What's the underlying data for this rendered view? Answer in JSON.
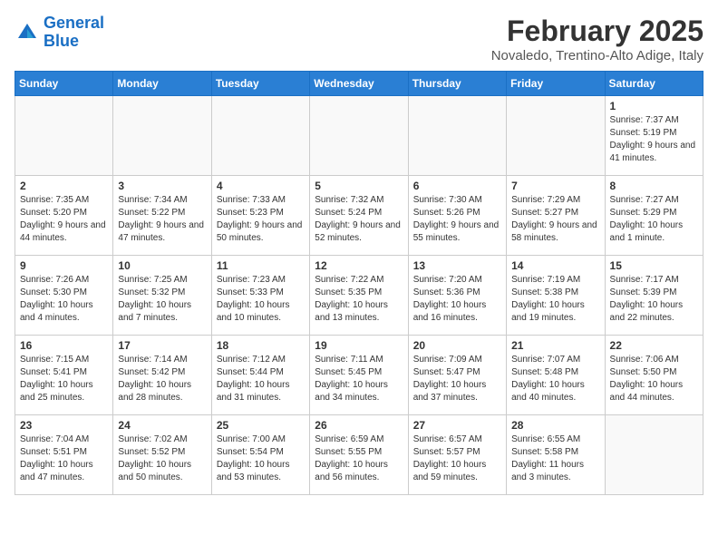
{
  "header": {
    "logo_line1": "General",
    "logo_line2": "Blue",
    "month_year": "February 2025",
    "location": "Novaledo, Trentino-Alto Adige, Italy"
  },
  "weekdays": [
    "Sunday",
    "Monday",
    "Tuesday",
    "Wednesday",
    "Thursday",
    "Friday",
    "Saturday"
  ],
  "weeks": [
    [
      {
        "day": "",
        "info": ""
      },
      {
        "day": "",
        "info": ""
      },
      {
        "day": "",
        "info": ""
      },
      {
        "day": "",
        "info": ""
      },
      {
        "day": "",
        "info": ""
      },
      {
        "day": "",
        "info": ""
      },
      {
        "day": "1",
        "info": "Sunrise: 7:37 AM\nSunset: 5:19 PM\nDaylight: 9 hours and 41 minutes."
      }
    ],
    [
      {
        "day": "2",
        "info": "Sunrise: 7:35 AM\nSunset: 5:20 PM\nDaylight: 9 hours and 44 minutes."
      },
      {
        "day": "3",
        "info": "Sunrise: 7:34 AM\nSunset: 5:22 PM\nDaylight: 9 hours and 47 minutes."
      },
      {
        "day": "4",
        "info": "Sunrise: 7:33 AM\nSunset: 5:23 PM\nDaylight: 9 hours and 50 minutes."
      },
      {
        "day": "5",
        "info": "Sunrise: 7:32 AM\nSunset: 5:24 PM\nDaylight: 9 hours and 52 minutes."
      },
      {
        "day": "6",
        "info": "Sunrise: 7:30 AM\nSunset: 5:26 PM\nDaylight: 9 hours and 55 minutes."
      },
      {
        "day": "7",
        "info": "Sunrise: 7:29 AM\nSunset: 5:27 PM\nDaylight: 9 hours and 58 minutes."
      },
      {
        "day": "8",
        "info": "Sunrise: 7:27 AM\nSunset: 5:29 PM\nDaylight: 10 hours and 1 minute."
      }
    ],
    [
      {
        "day": "9",
        "info": "Sunrise: 7:26 AM\nSunset: 5:30 PM\nDaylight: 10 hours and 4 minutes."
      },
      {
        "day": "10",
        "info": "Sunrise: 7:25 AM\nSunset: 5:32 PM\nDaylight: 10 hours and 7 minutes."
      },
      {
        "day": "11",
        "info": "Sunrise: 7:23 AM\nSunset: 5:33 PM\nDaylight: 10 hours and 10 minutes."
      },
      {
        "day": "12",
        "info": "Sunrise: 7:22 AM\nSunset: 5:35 PM\nDaylight: 10 hours and 13 minutes."
      },
      {
        "day": "13",
        "info": "Sunrise: 7:20 AM\nSunset: 5:36 PM\nDaylight: 10 hours and 16 minutes."
      },
      {
        "day": "14",
        "info": "Sunrise: 7:19 AM\nSunset: 5:38 PM\nDaylight: 10 hours and 19 minutes."
      },
      {
        "day": "15",
        "info": "Sunrise: 7:17 AM\nSunset: 5:39 PM\nDaylight: 10 hours and 22 minutes."
      }
    ],
    [
      {
        "day": "16",
        "info": "Sunrise: 7:15 AM\nSunset: 5:41 PM\nDaylight: 10 hours and 25 minutes."
      },
      {
        "day": "17",
        "info": "Sunrise: 7:14 AM\nSunset: 5:42 PM\nDaylight: 10 hours and 28 minutes."
      },
      {
        "day": "18",
        "info": "Sunrise: 7:12 AM\nSunset: 5:44 PM\nDaylight: 10 hours and 31 minutes."
      },
      {
        "day": "19",
        "info": "Sunrise: 7:11 AM\nSunset: 5:45 PM\nDaylight: 10 hours and 34 minutes."
      },
      {
        "day": "20",
        "info": "Sunrise: 7:09 AM\nSunset: 5:47 PM\nDaylight: 10 hours and 37 minutes."
      },
      {
        "day": "21",
        "info": "Sunrise: 7:07 AM\nSunset: 5:48 PM\nDaylight: 10 hours and 40 minutes."
      },
      {
        "day": "22",
        "info": "Sunrise: 7:06 AM\nSunset: 5:50 PM\nDaylight: 10 hours and 44 minutes."
      }
    ],
    [
      {
        "day": "23",
        "info": "Sunrise: 7:04 AM\nSunset: 5:51 PM\nDaylight: 10 hours and 47 minutes."
      },
      {
        "day": "24",
        "info": "Sunrise: 7:02 AM\nSunset: 5:52 PM\nDaylight: 10 hours and 50 minutes."
      },
      {
        "day": "25",
        "info": "Sunrise: 7:00 AM\nSunset: 5:54 PM\nDaylight: 10 hours and 53 minutes."
      },
      {
        "day": "26",
        "info": "Sunrise: 6:59 AM\nSunset: 5:55 PM\nDaylight: 10 hours and 56 minutes."
      },
      {
        "day": "27",
        "info": "Sunrise: 6:57 AM\nSunset: 5:57 PM\nDaylight: 10 hours and 59 minutes."
      },
      {
        "day": "28",
        "info": "Sunrise: 6:55 AM\nSunset: 5:58 PM\nDaylight: 11 hours and 3 minutes."
      },
      {
        "day": "",
        "info": ""
      }
    ]
  ]
}
